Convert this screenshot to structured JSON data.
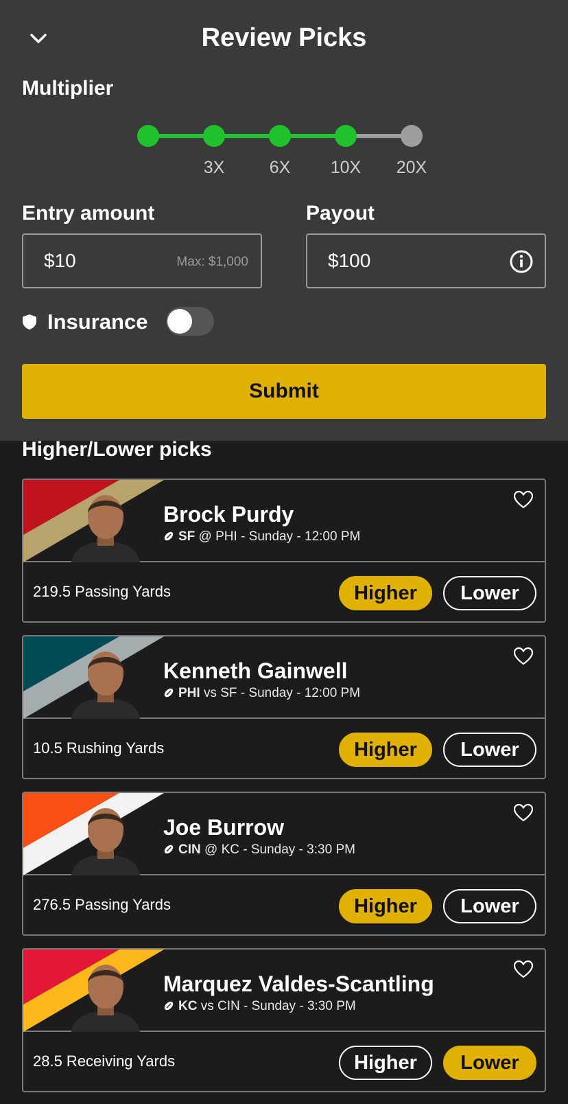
{
  "header": {
    "title": "Review Picks"
  },
  "multiplier": {
    "label": "Multiplier",
    "ticks": [
      "3X",
      "6X",
      "10X",
      "20X"
    ],
    "selected_stops": 4,
    "total_stops": 5,
    "active_color": "#22c22e",
    "inactive_color": "#9e9e9e"
  },
  "entry": {
    "label": "Entry amount",
    "value": "$10",
    "max_hint": "Max: $1,000"
  },
  "payout": {
    "label": "Payout",
    "value": "$100"
  },
  "insurance": {
    "label": "Insurance",
    "enabled": false
  },
  "submit_label": "Submit",
  "section_title": "Higher/Lower picks",
  "colors": {
    "accent": "#e0b102",
    "panel": "#3a3a3a",
    "background": "#1c1c1c"
  },
  "picks": [
    {
      "name": "Brock Purdy",
      "team": "SF",
      "matchup_rest": " @ PHI - Sunday - 12:00 PM",
      "stat": "219.5 Passing Yards",
      "higher_label": "Higher",
      "lower_label": "Lower",
      "selected": "higher",
      "stripe_colors": [
        "#c1121f",
        "#b8a36d"
      ]
    },
    {
      "name": "Kenneth Gainwell",
      "team": "PHI",
      "matchup_rest": " vs SF - Sunday - 12:00 PM",
      "stat": "10.5 Rushing Yards",
      "higher_label": "Higher",
      "lower_label": "Lower",
      "selected": "higher",
      "stripe_colors": [
        "#004c54",
        "#a5acaf"
      ]
    },
    {
      "name": "Joe Burrow",
      "team": "CIN",
      "matchup_rest": " @ KC - Sunday - 3:30 PM",
      "stat": "276.5 Passing Yards",
      "higher_label": "Higher",
      "lower_label": "Lower",
      "selected": "higher",
      "stripe_colors": [
        "#fb4f14",
        "#f2f2f2"
      ]
    },
    {
      "name": "Marquez Valdes-Scantling",
      "team": "KC",
      "matchup_rest": " vs CIN - Sunday - 3:30 PM",
      "stat": "28.5 Receiving Yards",
      "higher_label": "Higher",
      "lower_label": "Lower",
      "selected": "lower",
      "stripe_colors": [
        "#e31837",
        "#ffb81c"
      ]
    }
  ]
}
